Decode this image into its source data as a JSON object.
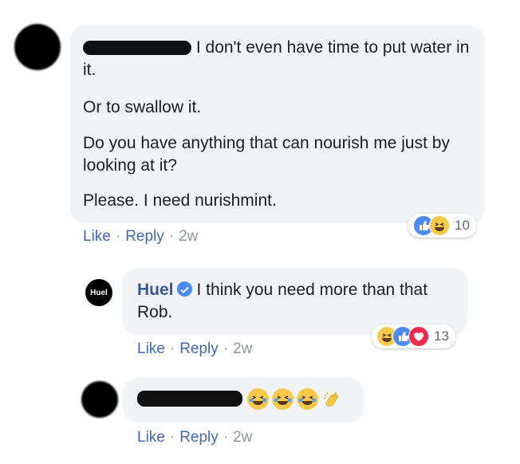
{
  "comment1": {
    "lines": [
      "I don't even have time to put water in it.",
      "Or to swallow it.",
      "Do you have anything that can nourish me just by looking at it?",
      "Please. I need nurishmint."
    ],
    "reaction_count": "10",
    "actions": {
      "like": "Like",
      "reply": "Reply",
      "time": "2w"
    }
  },
  "reply1": {
    "avatar_label": "Huel",
    "author": "Huel",
    "text": "I think you need more than that Rob.",
    "reaction_count": "13",
    "actions": {
      "like": "Like",
      "reply": "Reply",
      "time": "2w"
    }
  },
  "reply2": {
    "emojis": [
      "tears-of-joy-emoji",
      "tears-of-joy-emoji",
      "tears-of-joy-emoji",
      "clapping-hands-emoji"
    ],
    "actions": {
      "like": "Like",
      "reply": "Reply",
      "time": "2w"
    }
  }
}
